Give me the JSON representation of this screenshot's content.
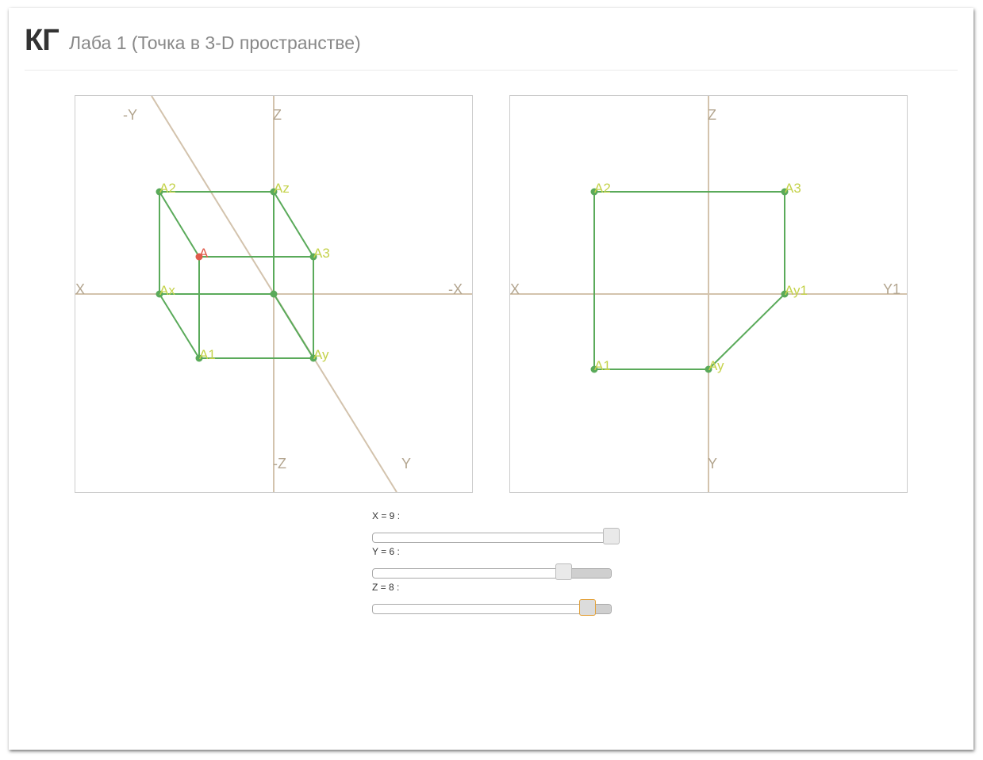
{
  "header": {
    "brand": "КГ",
    "subtitle": "Лаба 1 (Точка в 3-D пространстве)"
  },
  "colors": {
    "axis": "#d3c3ad",
    "axis_label": "#b3a58f",
    "edge": "#5aaa5a",
    "point": "#5aaa5a",
    "point_label": "#c4d24a",
    "main_point": "#e05a4a",
    "slider_focus": "#e3a23c"
  },
  "left_view": {
    "axis_labels": {
      "x": "X",
      "neg_x": "-X",
      "z": "Z",
      "neg_z": "-Z",
      "y": "Y",
      "neg_y": "-Y"
    },
    "points": {
      "A": "A",
      "A1": "A1",
      "A2": "A2",
      "A3": "A3",
      "Ax": "Ax",
      "Ay": "Ay",
      "Az": "Az"
    }
  },
  "right_view": {
    "axis_labels": {
      "x": "X",
      "y1": "Y1",
      "z": "Z",
      "y": "Y"
    },
    "points": {
      "A1": "A1",
      "A2": "A2",
      "A3": "A3",
      "Ay": "Ay",
      "Ay1": "Ay1"
    }
  },
  "sliders": [
    {
      "label": "X = 9 :",
      "value": 9,
      "min": 0,
      "max": 9
    },
    {
      "label": "Y = 6 :",
      "value": 6,
      "min": 0,
      "max": 7.5
    },
    {
      "label": "Z = 8 :",
      "value": 8,
      "min": 0,
      "max": 8.9,
      "focused": true
    }
  ]
}
